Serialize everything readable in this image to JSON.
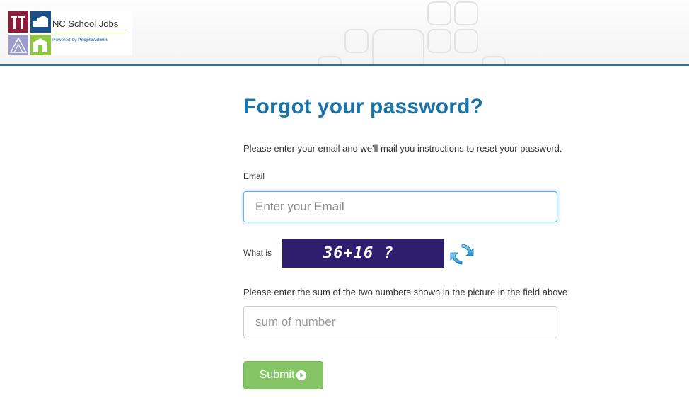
{
  "header": {
    "logo_title": "NC School Jobs",
    "logo_powered_prefix": "Powered by ",
    "logo_powered_brand": "PeopleAdmin"
  },
  "form": {
    "title": "Forgot your password?",
    "intro": "Please enter your email and we'll mail you instructions to reset your password.",
    "email_label": "Email",
    "email_placeholder": "Enter your Email",
    "email_value": "",
    "captcha_label": "What is",
    "captcha_text": "36+16 ?",
    "sum_instructions": "Please enter the sum of the two numbers shown in the picture in the field above",
    "sum_placeholder": "sum of number",
    "sum_value": "",
    "submit_label": "Submit"
  },
  "colors": {
    "title": "#1a75a9",
    "header_border": "#2d6f97",
    "captcha_bg": "#2d1f6e",
    "submit_bg": "#86c566",
    "focus_border": "#66afe9"
  },
  "icons": {
    "refresh": "refresh-icon",
    "submit": "play-circle-icon"
  }
}
